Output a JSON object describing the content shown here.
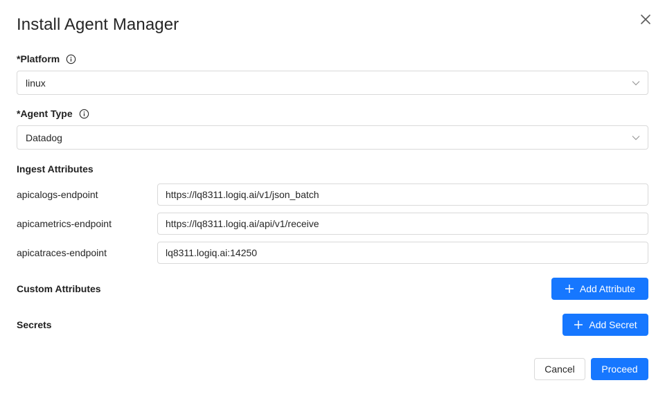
{
  "dialog": {
    "title": "Install Agent Manager"
  },
  "platform": {
    "label": "*Platform",
    "value": "linux"
  },
  "agent_type": {
    "label": "*Agent Type",
    "value": "Datadog"
  },
  "ingest": {
    "title": "Ingest Attributes",
    "attributes": [
      {
        "name": "apicalogs-endpoint",
        "value": "https://lq8311.logiq.ai/v1/json_batch"
      },
      {
        "name": "apicametrics-endpoint",
        "value": "https://lq8311.logiq.ai/api/v1/receive"
      },
      {
        "name": "apicatraces-endpoint",
        "value": "lq8311.logiq.ai:14250"
      }
    ]
  },
  "custom_attributes": {
    "title": "Custom Attributes",
    "button_label": "Add Attribute"
  },
  "secrets": {
    "title": "Secrets",
    "button_label": "Add Secret"
  },
  "footer": {
    "cancel_label": "Cancel",
    "proceed_label": "Proceed"
  },
  "colors": {
    "primary": "#1677ff",
    "border": "#d9d9d9"
  }
}
